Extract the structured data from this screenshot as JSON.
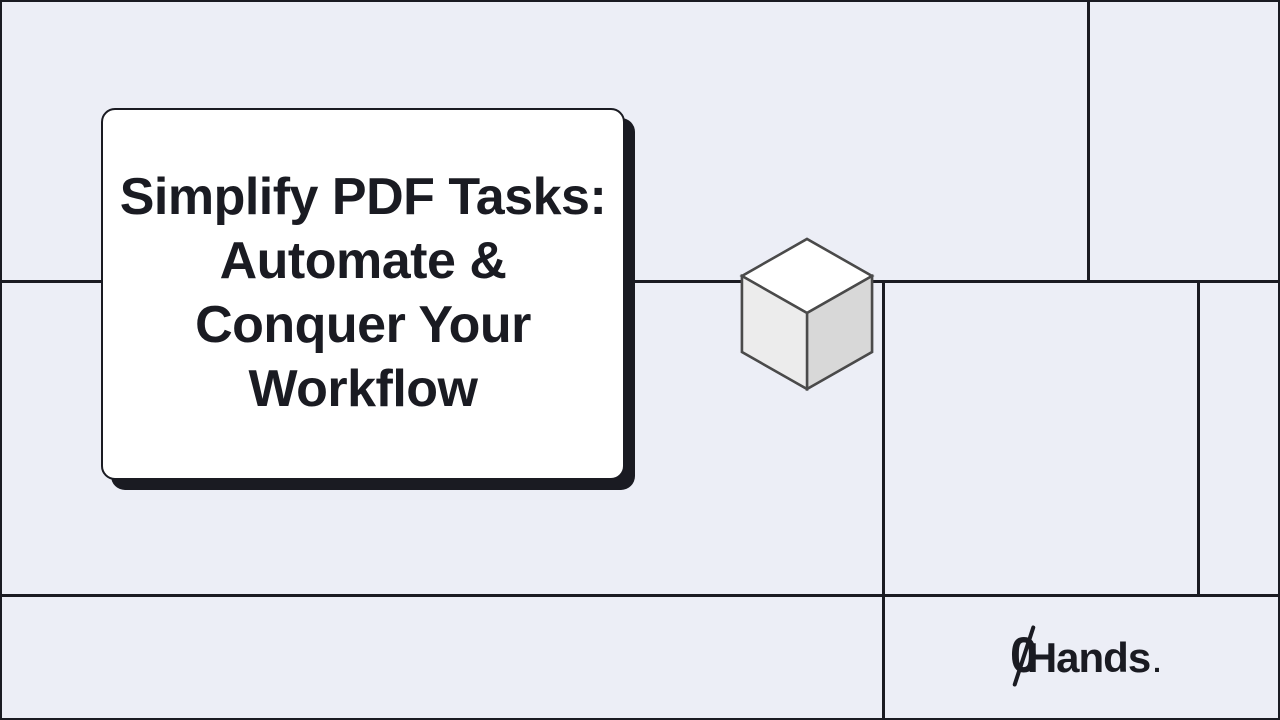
{
  "title": "Simplify PDF Tasks: Automate & Conquer Your Workflow",
  "brand": {
    "zero": "0",
    "text": "Hands",
    "dot": "."
  }
}
